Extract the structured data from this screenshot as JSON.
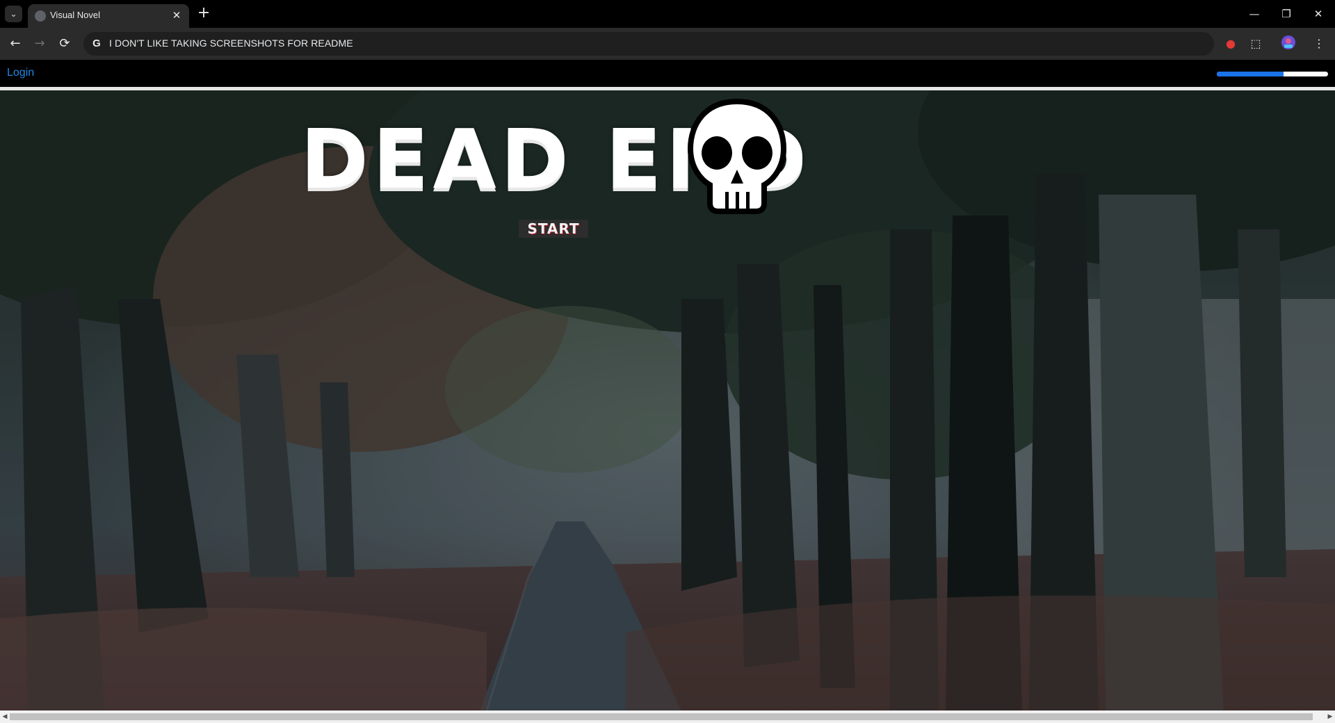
{
  "browser": {
    "tab": {
      "title": "Visual Novel",
      "close_label": "✕"
    },
    "new_tab_label": "+",
    "tab_search_label": "⌄",
    "address": "I DON'T LIKE TAKING SCREENSHOTS FOR README",
    "search_engine_label": "G",
    "controls": {
      "back": "←",
      "forward": "→",
      "reload": "⟳",
      "minimize": "—",
      "restore": "❐",
      "close": "✕",
      "menu": "⋮"
    }
  },
  "page": {
    "login_label": "Login",
    "progress": {
      "fraction": 0.6,
      "fill_color": "#1a73e8",
      "track_color": "#ffffff"
    },
    "title": "DEAD END",
    "start_label": "START"
  },
  "scene": {
    "icons": [
      "skull-icon"
    ]
  }
}
